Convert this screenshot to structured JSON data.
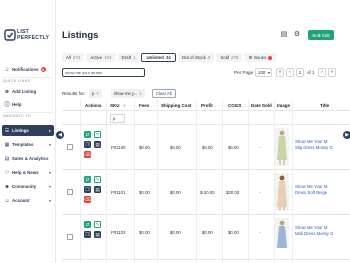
{
  "sidebar": {
    "logo_text": "LIST\nPERFECTLY",
    "notifications": {
      "label": "Notifications",
      "badge": "5"
    },
    "quick_links_heading": "QUICK LINKS",
    "add_listing": "Add Listing",
    "help": "Help",
    "navigate_heading": "NAVIGATE TO",
    "items": [
      {
        "label": "Listings",
        "active": true
      },
      {
        "label": "Templates"
      },
      {
        "label": "Sales & Analytics"
      },
      {
        "label": "Help & News"
      },
      {
        "label": "Community"
      },
      {
        "label": "Account"
      }
    ],
    "accent_color": "#2f3f5c"
  },
  "header": {
    "title": "Listings",
    "bulk_button": "Bulk Edit",
    "accent_color": "#1fa37a"
  },
  "tabs": [
    {
      "label": "All",
      "count": "274"
    },
    {
      "label": "Active",
      "count": "441"
    },
    {
      "label": "Draft",
      "count": "1"
    },
    {
      "label": "Unlisted",
      "count": "34",
      "active": true
    },
    {
      "label": "Out of Stock",
      "count": "3"
    },
    {
      "label": "Sold",
      "count": "275"
    },
    {
      "label": "Issues"
    }
  ],
  "search": {
    "value": "show me your mumu"
  },
  "pagination": {
    "per_page_label": "Per Page",
    "per_page": "100",
    "current_page": "1",
    "of_label": "of 1"
  },
  "filters": {
    "results_label": "Results for:",
    "chips": [
      "p",
      "show me y..."
    ],
    "clear_all": "Clear All",
    "sku_filter": "p"
  },
  "table": {
    "columns": [
      "Actions",
      "SKU",
      "Fees",
      "Shipping Cost",
      "Profit",
      "COGS",
      "Date Sold",
      "Image",
      "Title"
    ],
    "rows": [
      {
        "sku": "P01100",
        "fees": "$0.00",
        "shipping": "$0.00",
        "profit": "$0.00",
        "cogs": "$0.00",
        "date_sold": "-",
        "title": [
          "Show Me Your M",
          "Slip Dress Mossy G"
        ]
      },
      {
        "sku": "P01101",
        "fees": "$0.00",
        "shipping": "$0.00",
        "profit": "$-20.00",
        "cogs": "$20.00",
        "date_sold": "-",
        "title": [
          "Show Me Your M",
          "Dress Soft Beige"
        ]
      },
      {
        "sku": "P01102",
        "fees": "$0.00",
        "shipping": "$0.00",
        "profit": "$0.00",
        "cogs": "$0.00",
        "date_sold": "-",
        "title": [
          "Show Me Your M",
          "Midi Dress Mossy G"
        ]
      }
    ]
  }
}
